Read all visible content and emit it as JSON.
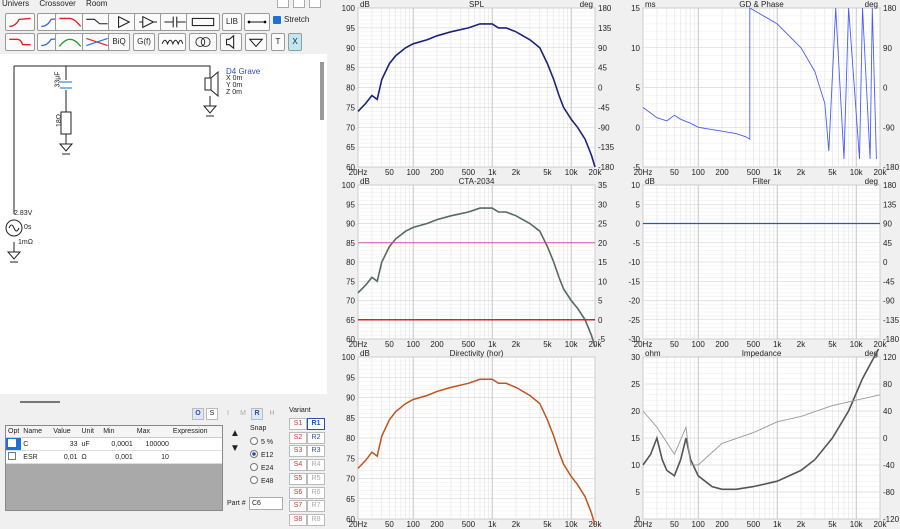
{
  "menu": [
    "Univers",
    "Crossover",
    "Room"
  ],
  "toolbar": {
    "lib": "LIB",
    "biq": "BiQ",
    "gf": "G(f)",
    "stretch": "Stretch",
    "t": "T",
    "x": "X"
  },
  "schematic": {
    "cap_value": "33µF",
    "res_value": "18Ω",
    "driver_name": "D4 Grave",
    "driver_x": "X 0m",
    "driver_y": "Y 0m",
    "driver_z": "Z 0m",
    "source_voltage": "2.83V",
    "source_delay": "0s",
    "source_impedance": "1mΩ"
  },
  "charts": {
    "spl": {
      "title": "SPL",
      "left_unit": "dB",
      "right_unit": "deg",
      "left_ticks": [
        "100",
        "95",
        "90",
        "85",
        "80",
        "75",
        "70",
        "65",
        "60"
      ],
      "right_ticks": [
        "180",
        "135",
        "90",
        "45",
        "0",
        "-45",
        "-90",
        "-135",
        "-180"
      ]
    },
    "gd": {
      "title": "GD & Phase",
      "left_unit": "ms",
      "right_unit": "deg",
      "left_ticks": [
        "15",
        "10",
        "5",
        "0",
        "-5"
      ],
      "right_ticks": [
        "180",
        "90",
        "0",
        "-90",
        "-180"
      ]
    },
    "cta": {
      "title": "CTA-2034",
      "left_unit": "dB",
      "right_unit": "",
      "left_ticks": [
        "100",
        "95",
        "90",
        "85",
        "80",
        "75",
        "70",
        "65",
        "60"
      ],
      "right_ticks": [
        "35",
        "30",
        "25",
        "20",
        "15",
        "10",
        "5",
        "0",
        "-5"
      ]
    },
    "filter": {
      "title": "Filter",
      "left_unit": "dB",
      "right_unit": "deg",
      "left_ticks": [
        "10",
        "5",
        "0",
        "-5",
        "-10",
        "-15",
        "-20",
        "-25",
        "-30"
      ],
      "right_ticks": [
        "180",
        "135",
        "90",
        "45",
        "0",
        "-45",
        "-90",
        "-135",
        "-180"
      ]
    },
    "dir": {
      "title": "Directivity (hor)",
      "left_unit": "dB",
      "right_unit": "",
      "left_ticks": [
        "100",
        "95",
        "90",
        "85",
        "80",
        "75",
        "70",
        "65",
        "60"
      ],
      "right_ticks": []
    },
    "imp": {
      "title": "Impedance",
      "left_unit": "ohm",
      "right_unit": "deg",
      "left_ticks": [
        "30",
        "25",
        "20",
        "15",
        "10",
        "5",
        "0"
      ],
      "right_ticks": [
        "120",
        "80",
        "40",
        "0",
        "-40",
        "-80",
        "-120"
      ]
    },
    "x_ticks": [
      "20Hz",
      "50",
      "100",
      "200",
      "500",
      "1k",
      "2k",
      "5k",
      "10k",
      "20k"
    ]
  },
  "params": {
    "headers": [
      "Opt",
      "Name",
      "Value",
      "Unit",
      "Min",
      "Max",
      "Expression"
    ],
    "rows": [
      {
        "name": "C",
        "value": "33",
        "unit": "uF",
        "min": "0,0001",
        "max": "100000",
        "expr": ""
      },
      {
        "name": "ESR",
        "value": "0,01",
        "unit": "Ω",
        "min": "0,001",
        "max": "10",
        "expr": ""
      }
    ]
  },
  "mode_buttons": [
    "O",
    "S",
    "I",
    "M",
    "R",
    "H"
  ],
  "snap": {
    "label": "Snap",
    "options": [
      "5 %",
      "E12",
      "E24",
      "E48"
    ],
    "selected": "E12"
  },
  "variant": {
    "label": "Variant",
    "s": [
      "S1",
      "S2",
      "S3",
      "S4",
      "S5",
      "S6",
      "S7",
      "S8"
    ],
    "r": [
      "R1",
      "R2",
      "R3",
      "R4",
      "R5",
      "R6",
      "R7",
      "R8"
    ]
  },
  "part": {
    "label": "Part #",
    "value": "C6"
  }
}
